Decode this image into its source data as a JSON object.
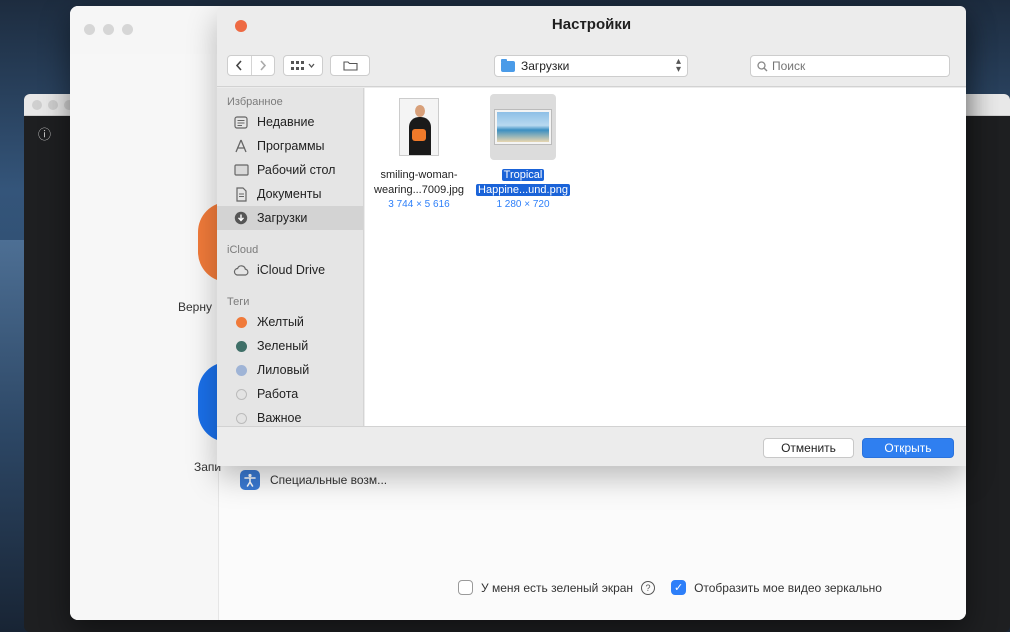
{
  "dialog": {
    "title": "Настройки",
    "location": "Загрузки",
    "search_placeholder": "Поиск",
    "cancel_label": "Отменить",
    "open_label": "Открыть"
  },
  "sidebar": {
    "favorites_header": "Избранное",
    "favorites": [
      {
        "label": "Недавние",
        "icon": "clock-icon"
      },
      {
        "label": "Программы",
        "icon": "apps-icon"
      },
      {
        "label": "Рабочий стол",
        "icon": "desktop-icon"
      },
      {
        "label": "Документы",
        "icon": "document-icon"
      },
      {
        "label": "Загрузки",
        "icon": "download-icon"
      }
    ],
    "icloud_header": "iCloud",
    "icloud": [
      {
        "label": "iCloud Drive",
        "icon": "cloud-icon"
      }
    ],
    "tags_header": "Теги",
    "tags": [
      {
        "label": "Желтый",
        "color": "#f07a3a"
      },
      {
        "label": "Зеленый",
        "color": "#3f6f68"
      },
      {
        "label": "Лиловый",
        "color": "#9fb4d6"
      },
      {
        "label": "Работа",
        "color": "#e3e3e3"
      },
      {
        "label": "Важное",
        "color": "#e3e3e3"
      }
    ]
  },
  "files": [
    {
      "name_line1": "smiling-woman-",
      "name_line2": "wearing...7009.jpg",
      "dims": "3 744 × 5 616",
      "selected": false
    },
    {
      "name_line1": "Tropical",
      "name_line2": "Happine...und.png",
      "dims": "1 280 × 720",
      "selected": true
    }
  ],
  "zoom": {
    "label_return": "Верну",
    "label_record": "Запи",
    "accessibility_label": "Специальные возм...",
    "green_screen_label": "У меня есть зеленый экран",
    "mirror_label": "Отобразить мое видео зеркально"
  },
  "colors": {
    "accent": "#2f7ff0",
    "close_button": "#ee6a43",
    "orange_circle": "#f07a3a",
    "blue_circle": "#1a6fe8"
  }
}
